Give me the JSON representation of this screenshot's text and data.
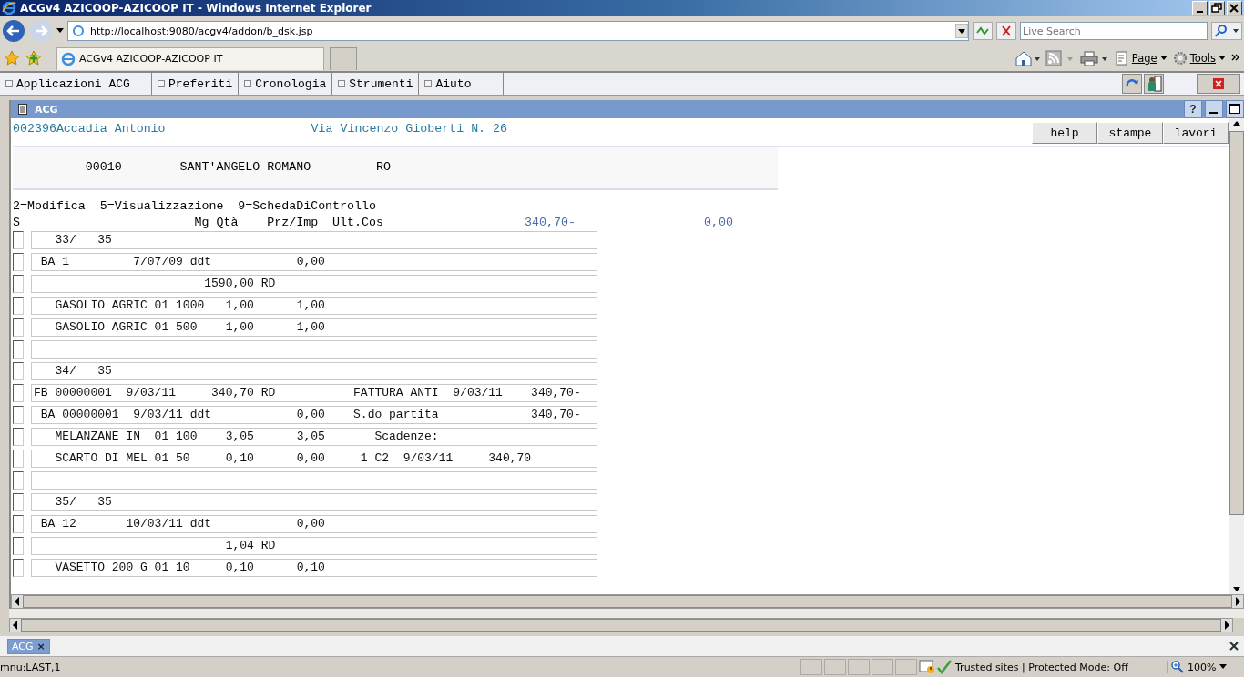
{
  "window": {
    "title": "ACGv4 AZICOOP-AZICOOP IT - Windows Internet Explorer"
  },
  "address_bar": {
    "url": "http://localhost:9080/acgv4/addon/b_dsk.jsp"
  },
  "search": {
    "placeholder": "Live Search"
  },
  "browser_tab": {
    "title": "ACGv4 AZICOOP-AZICOOP IT"
  },
  "command_bar": [
    "Page",
    "Tools"
  ],
  "app_menu": [
    {
      "label": "Applicazioni ACG"
    },
    {
      "label": "Preferiti"
    },
    {
      "label": "Cronologia"
    },
    {
      "label": "Strumenti"
    },
    {
      "label": "Aiuto"
    }
  ],
  "inner_window": {
    "title": "ACG",
    "help_glyph": "?"
  },
  "header": {
    "customer": "002396Accadia Antonio",
    "address": "Via Vincenzo Gioberti N. 26",
    "buttons": [
      "help",
      "stampe",
      "lavori"
    ],
    "city_line": "          00010        SANT'ANGELO ROMANO         RO",
    "options": "2=Modifica  5=Visualizzazione  9=SchedaDiControllo",
    "columns": "S                        Mg Qtà    Prz/Imp  Ult.Cos",
    "total_1": "340,70-",
    "total_2": "0,00"
  },
  "rows": [
    {
      "text": "   33/   35",
      "checked": false
    },
    {
      "text": " BA 1         7/07/09 ddt            0,00",
      "checked": false
    },
    {
      "text": "                        1590,00 RD",
      "checked": false
    },
    {
      "text": "   GASOLIO AGRIC 01 1000   1,00      1,00",
      "checked": false
    },
    {
      "text": "   GASOLIO AGRIC 01 500    1,00      1,00",
      "checked": false
    },
    {
      "text": "",
      "checked": false
    },
    {
      "text": "   34/   35",
      "checked": false
    },
    {
      "text": "FB 00000001  9/03/11     340,70 RD           FATTURA ANTI  9/03/11    340,70-",
      "checked": false
    },
    {
      "text": " BA 00000001  9/03/11 ddt            0,00    S.do partita             340,70-",
      "checked": false
    },
    {
      "text": "   MELANZANE IN  01 100    3,05      3,05       Scadenze:",
      "checked": false
    },
    {
      "text": "   SCARTO DI MEL 01 50     0,10      0,00     1 C2  9/03/11     340,70",
      "checked": false
    },
    {
      "text": "",
      "checked": false
    },
    {
      "text": "   35/   35",
      "checked": false
    },
    {
      "text": " BA 12       10/03/11 ddt            0,00",
      "checked": false
    },
    {
      "text": "                           1,04 RD",
      "checked": false
    },
    {
      "text": "   VASETTO 200 G 01 10     0,10      0,10",
      "checked": false
    }
  ],
  "task_tabs": [
    {
      "label": "ACG",
      "selected": true,
      "close_glyph": "×"
    }
  ],
  "status_bar": {
    "text": "mnu:LAST,1",
    "zone": "Trusted sites | Protected Mode: Off",
    "zoom": "100%"
  }
}
